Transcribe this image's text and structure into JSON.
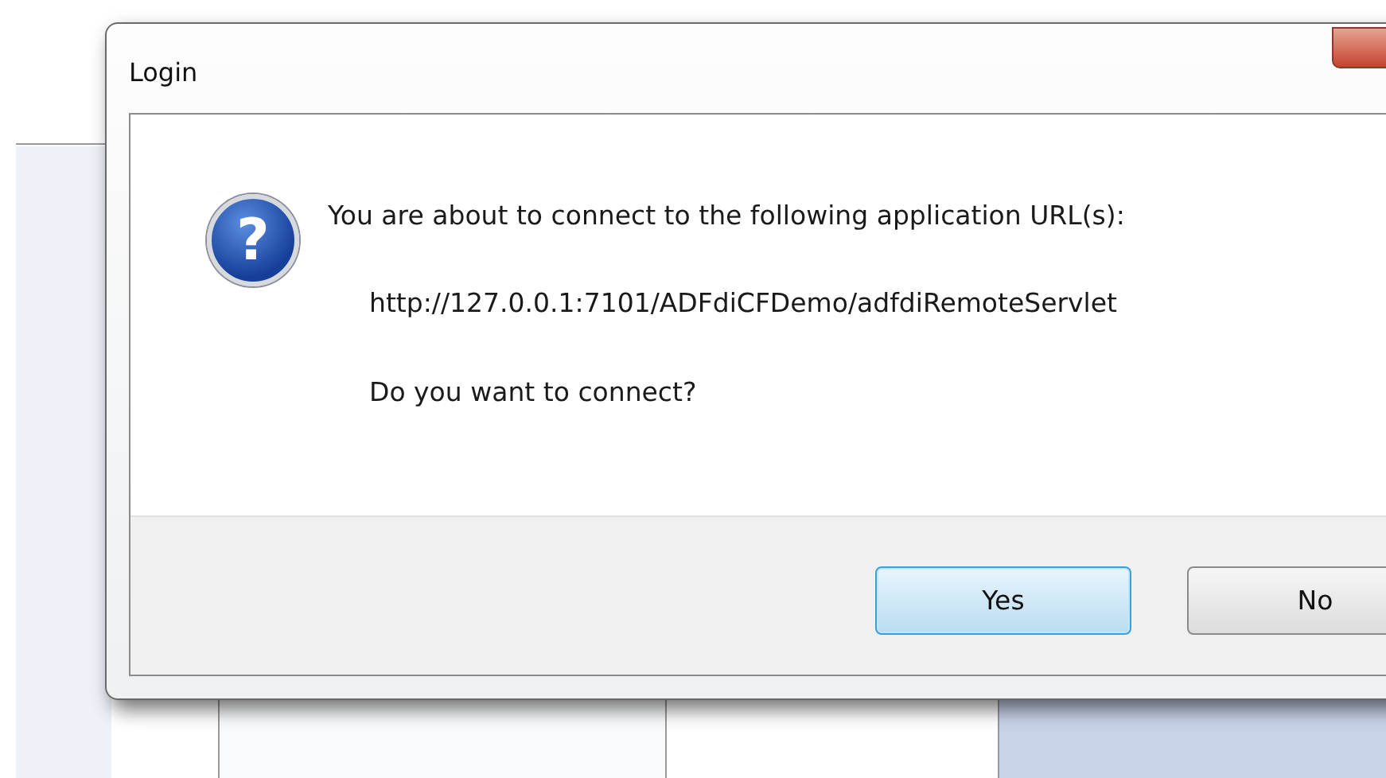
{
  "dialog": {
    "title": "Login",
    "icon_glyph": "?",
    "message": "You are about to connect to the following application URL(s):",
    "url": "http://127.0.0.1:7101/ADFdiCFDemo/adfdiRemoteServlet",
    "question": "Do you want to connect?",
    "buttons": [
      {
        "label": "Yes",
        "selected": true
      },
      {
        "label": "No",
        "selected": false
      }
    ]
  }
}
